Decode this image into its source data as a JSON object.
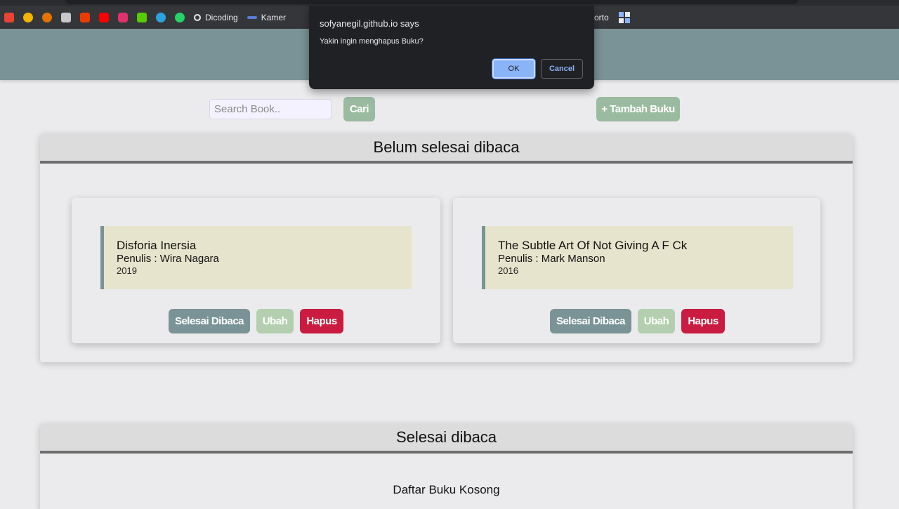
{
  "browser": {
    "bookmarks": [
      {
        "icon": "gmail-icon",
        "label": "",
        "color": "#ea4335"
      },
      {
        "icon": "university-icon",
        "label": "",
        "color": "#f4b400"
      },
      {
        "icon": "shield-icon",
        "label": "",
        "color": "#e37400"
      },
      {
        "icon": "calculator-icon",
        "label": "",
        "color": "#c8c8c8"
      },
      {
        "icon": "office-icon",
        "label": "",
        "color": "#eb3c00"
      },
      {
        "icon": "youtube-icon",
        "label": "",
        "color": "#ff0000"
      },
      {
        "icon": "instagram-icon",
        "label": "",
        "color": "#e1306c"
      },
      {
        "icon": "duolingo-icon",
        "label": "",
        "color": "#58cc02"
      },
      {
        "icon": "telegram-icon",
        "label": "",
        "color": "#2aa3df"
      },
      {
        "icon": "whatsapp-icon",
        "label": "",
        "color": "#25d366"
      },
      {
        "icon": "dicoding-icon",
        "label": "Dicoding",
        "color": "#e8eaed"
      },
      {
        "icon": "kamer-icon",
        "label": "Kamer",
        "color": "#5b7bd5"
      }
    ],
    "bookmark_right_label": "orto",
    "apps_icon": "apps-grid-icon"
  },
  "dialog": {
    "origin": "sofyanegil.github.io says",
    "message": "Yakin ingin menghapus Buku?",
    "ok_label": "OK",
    "cancel_label": "Cancel"
  },
  "toolbar": {
    "search_placeholder": "Search Book..",
    "search_button": "Cari",
    "add_button": "+ Tambah Buku"
  },
  "unread_section": {
    "title": "Belum selesai dibaca",
    "books": [
      {
        "title": "Disforia Inersia",
        "author": "Penulis : Wira Nagara",
        "year": "2019"
      },
      {
        "title": "The Subtle Art Of Not Giving A F Ck",
        "author": "Penulis : Mark Manson",
        "year": "2016"
      }
    ],
    "actions": {
      "done": "Selesai Dibaca",
      "edit": "Ubah",
      "delete": "Hapus"
    }
  },
  "read_section": {
    "title": "Selesai dibaca",
    "empty_message": "Daftar Buku Kosong"
  },
  "colors": {
    "header": "#7a9396",
    "button_green": "#9bbba0",
    "delete_red": "#c91c40",
    "card_info_bg": "#e6e4cc"
  }
}
